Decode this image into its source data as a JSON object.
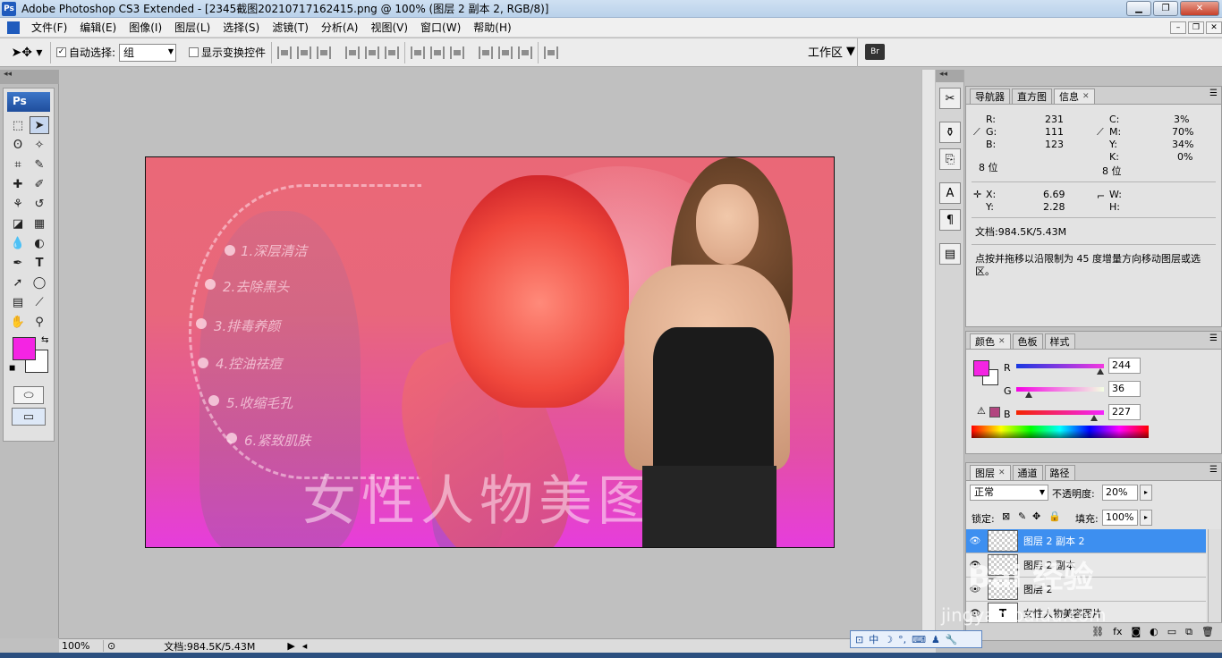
{
  "window": {
    "title": "Adobe Photoshop CS3 Extended - [2345截图20210717162415.png @ 100% (图层 2 副本 2, RGB/8)]",
    "app_icon": "Ps",
    "controls": [
      "minimize",
      "maximize",
      "close"
    ]
  },
  "menu": [
    "文件(F)",
    "编辑(E)",
    "图像(I)",
    "图层(L)",
    "选择(S)",
    "滤镜(T)",
    "分析(A)",
    "视图(V)",
    "窗口(W)",
    "帮助(H)"
  ],
  "options": {
    "auto_select_label": "自动选择:",
    "auto_select_checked": true,
    "auto_select_value": "组",
    "transform_label": "显示变换控件",
    "transform_checked": false,
    "workspace_label": "工作区"
  },
  "toolbox": {
    "logo": "Ps",
    "fg_color": "#f424e3",
    "bg_color": "#ffffff"
  },
  "canvas": {
    "steps": [
      "1.深层清洁",
      "2.去除黑头",
      "3.排毒养颜",
      "4.控油祛痘",
      "5.收缩毛孔",
      "6.紧致肌肤"
    ],
    "headline": "女性人物美图片"
  },
  "status": {
    "zoom": "100%",
    "doc": "文档:984.5K/5.43M"
  },
  "info_panel": {
    "tabs": [
      "导航器",
      "直方图",
      "信息"
    ],
    "active_tab": "信息",
    "rgb": {
      "R": "231",
      "G": "111",
      "B": "123"
    },
    "cmyk": {
      "C": "3%",
      "M": "70%",
      "Y": "34%",
      "K": "0%"
    },
    "bit_left": "8 位",
    "bit_right": "8 位",
    "x": "6.69",
    "y": "2.28",
    "w": "",
    "h": "",
    "doc": "文档:984.5K/5.43M",
    "hint": "点按并拖移以沿限制为 45 度增量方向移动图层或选区。"
  },
  "color_panel": {
    "tabs": [
      "颜色",
      "色板",
      "样式"
    ],
    "active_tab": "颜色",
    "R": "244",
    "G": "36",
    "B": "227",
    "R_frac": 0.957,
    "G_frac": 0.141,
    "B_frac": 0.89
  },
  "layers_panel": {
    "tabs": [
      "图层",
      "通道",
      "路径"
    ],
    "active_tab": "图层",
    "blend_mode": "正常",
    "opacity_label": "不透明度:",
    "opacity": "20%",
    "lock_label": "锁定:",
    "fill_label": "填充:",
    "fill": "100%",
    "layers": [
      {
        "name": "图层 2 副本 2",
        "selected": true
      },
      {
        "name": "图层 2 副本",
        "selected": false
      },
      {
        "name": "图层 2",
        "selected": false
      },
      {
        "name": "女性人物美容图片",
        "selected": false
      }
    ]
  },
  "ime": {
    "mode": "中"
  },
  "watermark": {
    "main": "Bai 经验",
    "sub": "jingyan.baidu.com"
  }
}
